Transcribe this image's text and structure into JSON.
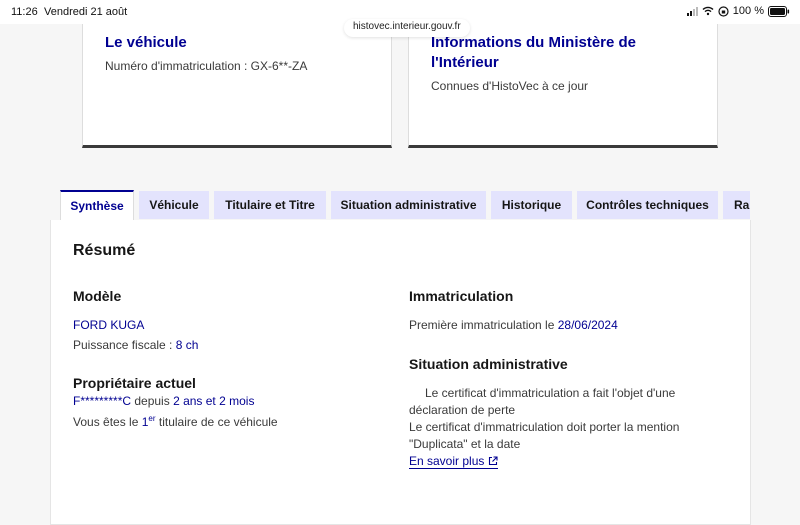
{
  "status_bar": {
    "time": "11:26",
    "date": "Vendredi 21 août",
    "url": "histovec.interieur.gouv.fr",
    "battery": "100 %"
  },
  "cards": {
    "vehicle": {
      "title": "Le véhicule",
      "subtitle": "Numéro d'immatriculation : GX-6**-ZA"
    },
    "ministry": {
      "title_line1": "Informations du Ministère de",
      "title_line2": "l'Intérieur",
      "subtitle": "Connues d'HistoVec à ce jour"
    }
  },
  "tabs": [
    {
      "label": "Synthèse",
      "active": true
    },
    {
      "label": "Véhicule",
      "active": false
    },
    {
      "label": "Titulaire et Titre",
      "active": false
    },
    {
      "label": "Situation administrative",
      "active": false
    },
    {
      "label": "Historique",
      "active": false
    },
    {
      "label": "Contrôles techniques",
      "active": false
    },
    {
      "label": "Rap",
      "active": false
    }
  ],
  "summary": {
    "title": "Résumé",
    "model": {
      "heading": "Modèle",
      "name": "FORD KUGA",
      "fiscal_power_label": "Puissance fiscale : ",
      "fiscal_power_value": "8 ch"
    },
    "owner": {
      "heading": "Propriétaire actuel",
      "name": "F*********C",
      "since_label": " depuis ",
      "since_value": "2 ans et 2 mois",
      "rank_prefix": "Vous êtes le ",
      "rank_number": "1",
      "rank_suffix": "er",
      "rank_rest": " titulaire de ce véhicule"
    },
    "registration": {
      "heading": "Immatriculation",
      "first_label": "Première immatriculation le ",
      "first_date": "28/06/2024"
    },
    "admin": {
      "heading": "Situation administrative",
      "line1": "Le certificat d'immatriculation a fait l'objet d'une",
      "line2": "déclaration de perte",
      "line3": "Le certificat d'immatriculation doit porter la mention",
      "line4": "\"Duplicata\" et la date",
      "link": "En savoir plus"
    }
  },
  "colors": {
    "accent": "#000091",
    "tab_bg": "#e3e3fd"
  }
}
